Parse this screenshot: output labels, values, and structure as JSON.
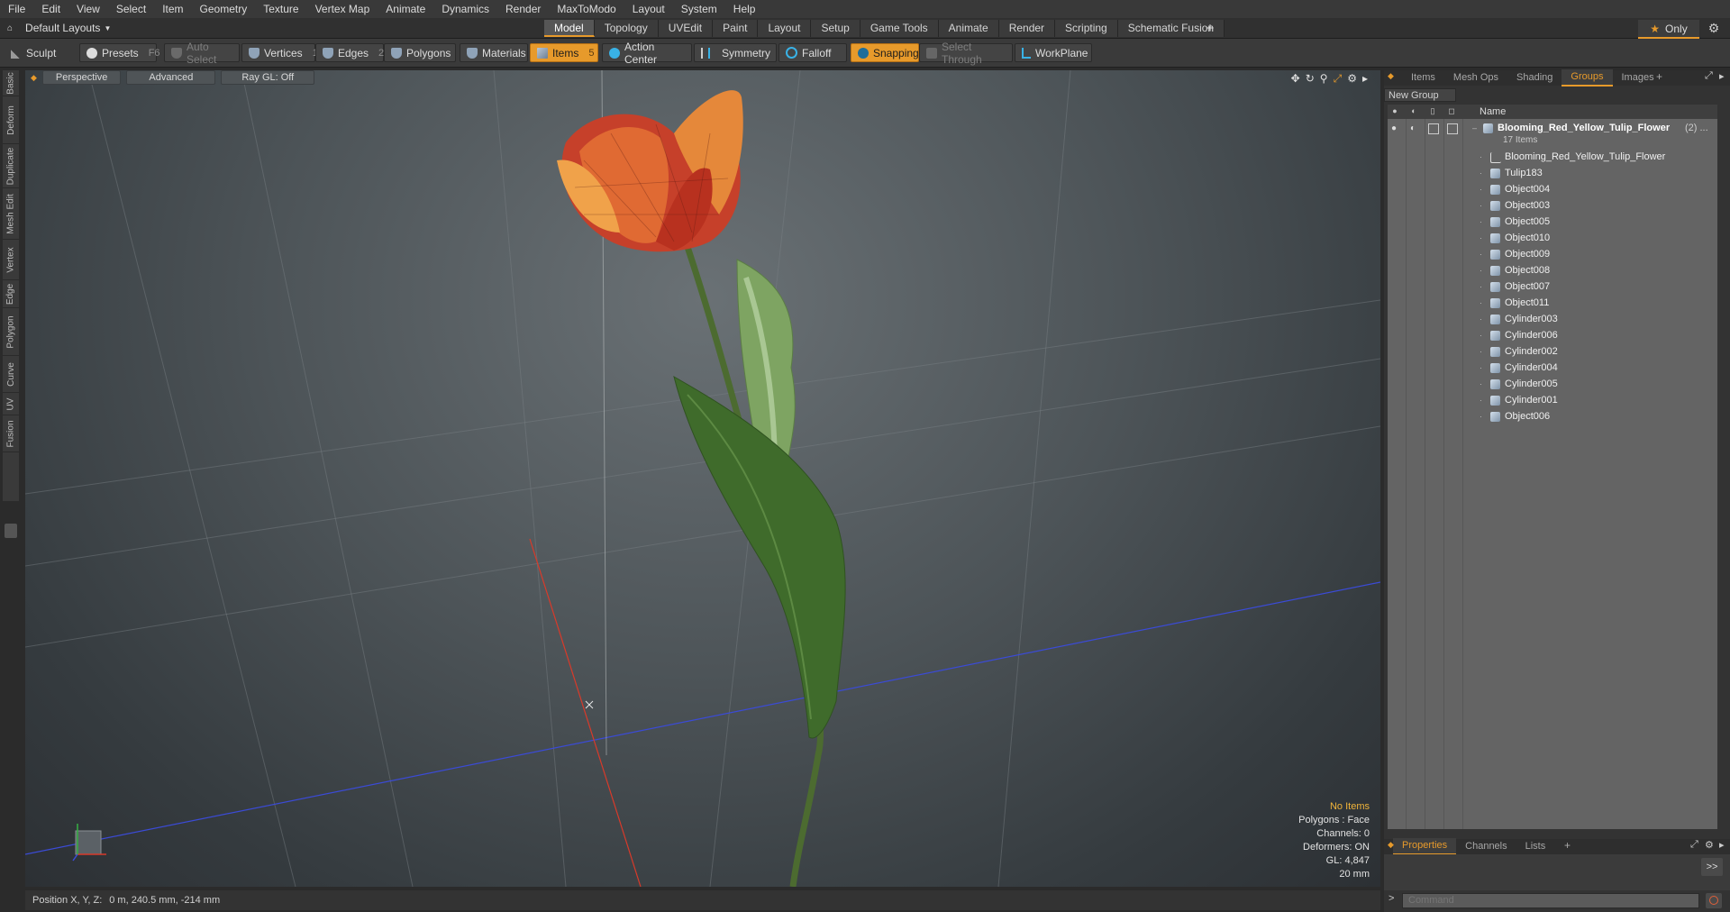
{
  "menu": [
    "File",
    "Edit",
    "View",
    "Select",
    "Item",
    "Geometry",
    "Texture",
    "Vertex Map",
    "Animate",
    "Dynamics",
    "Render",
    "MaxToModo",
    "Layout",
    "System",
    "Help"
  ],
  "layout_selector": {
    "label": "Default Layouts"
  },
  "mode_tabs": [
    {
      "label": "Model",
      "active": true
    },
    {
      "label": "Topology"
    },
    {
      "label": "UVEdit"
    },
    {
      "label": "Paint"
    },
    {
      "label": "Layout"
    },
    {
      "label": "Setup"
    },
    {
      "label": "Game Tools"
    },
    {
      "label": "Animate"
    },
    {
      "label": "Render"
    },
    {
      "label": "Scripting"
    },
    {
      "label": "Schematic Fusion"
    }
  ],
  "add_tab": "+",
  "only_label": "Only",
  "toolbar": {
    "sculpt": "Sculpt",
    "presets": "Presets",
    "presets_key": "F6",
    "auto_select": "Auto Select",
    "vertices": "Vertices",
    "vertices_num": "1",
    "edges": "Edges",
    "edges_num": "2",
    "polygons": "Polygons",
    "materials": "Materials",
    "items": "Items",
    "items_num": "5",
    "action_center": "Action Center",
    "symmetry": "Symmetry",
    "falloff": "Falloff",
    "snapping": "Snapping",
    "select_through": "Select Through",
    "workplane": "WorkPlane"
  },
  "left_tabs": [
    "Basic",
    "Deform",
    "Duplicate",
    "Mesh Edit",
    "Vertex",
    "Edge",
    "Polygon",
    "Curve",
    "UV",
    "Fusion"
  ],
  "viewport": {
    "perspective": "Perspective",
    "advanced": "Advanced",
    "raygl": "Ray GL: Off",
    "info": {
      "no_items": "No Items",
      "polygons": "Polygons : Face",
      "channels": "Channels: 0",
      "deformers": "Deformers: ON",
      "gl": "GL: 4,847",
      "scale": "20 mm"
    }
  },
  "status": {
    "label": "Position X, Y, Z:",
    "value": "0 m, 240.5 mm, -214 mm"
  },
  "right_panel": {
    "tabs": [
      {
        "label": "Items"
      },
      {
        "label": "Mesh Ops"
      },
      {
        "label": "Shading"
      },
      {
        "label": "Groups",
        "active": true
      },
      {
        "label": "Images"
      }
    ],
    "new_group": "New Group",
    "name_header": "Name",
    "group": {
      "name": "Blooming_Red_Yellow_Tulip_Flower",
      "count_suffix": "(2) ...",
      "items_count": "17 Items"
    },
    "items": [
      "Blooming_Red_Yellow_Tulip_Flower",
      "Tulip183",
      "Object004",
      "Object003",
      "Object005",
      "Object010",
      "Object009",
      "Object008",
      "Object007",
      "Object011",
      "Cylinder003",
      "Cylinder006",
      "Cylinder002",
      "Cylinder004",
      "Cylinder005",
      "Cylinder001",
      "Object006"
    ],
    "bottom_tabs": [
      {
        "label": "Properties",
        "active": true
      },
      {
        "label": "Channels"
      },
      {
        "label": "Lists"
      }
    ],
    "expand": ">>",
    "command_placeholder": "Command"
  },
  "colors": {
    "accent": "#e79a2b",
    "x_axis": "#d83a2a",
    "z_axis": "#3b4bd6"
  }
}
